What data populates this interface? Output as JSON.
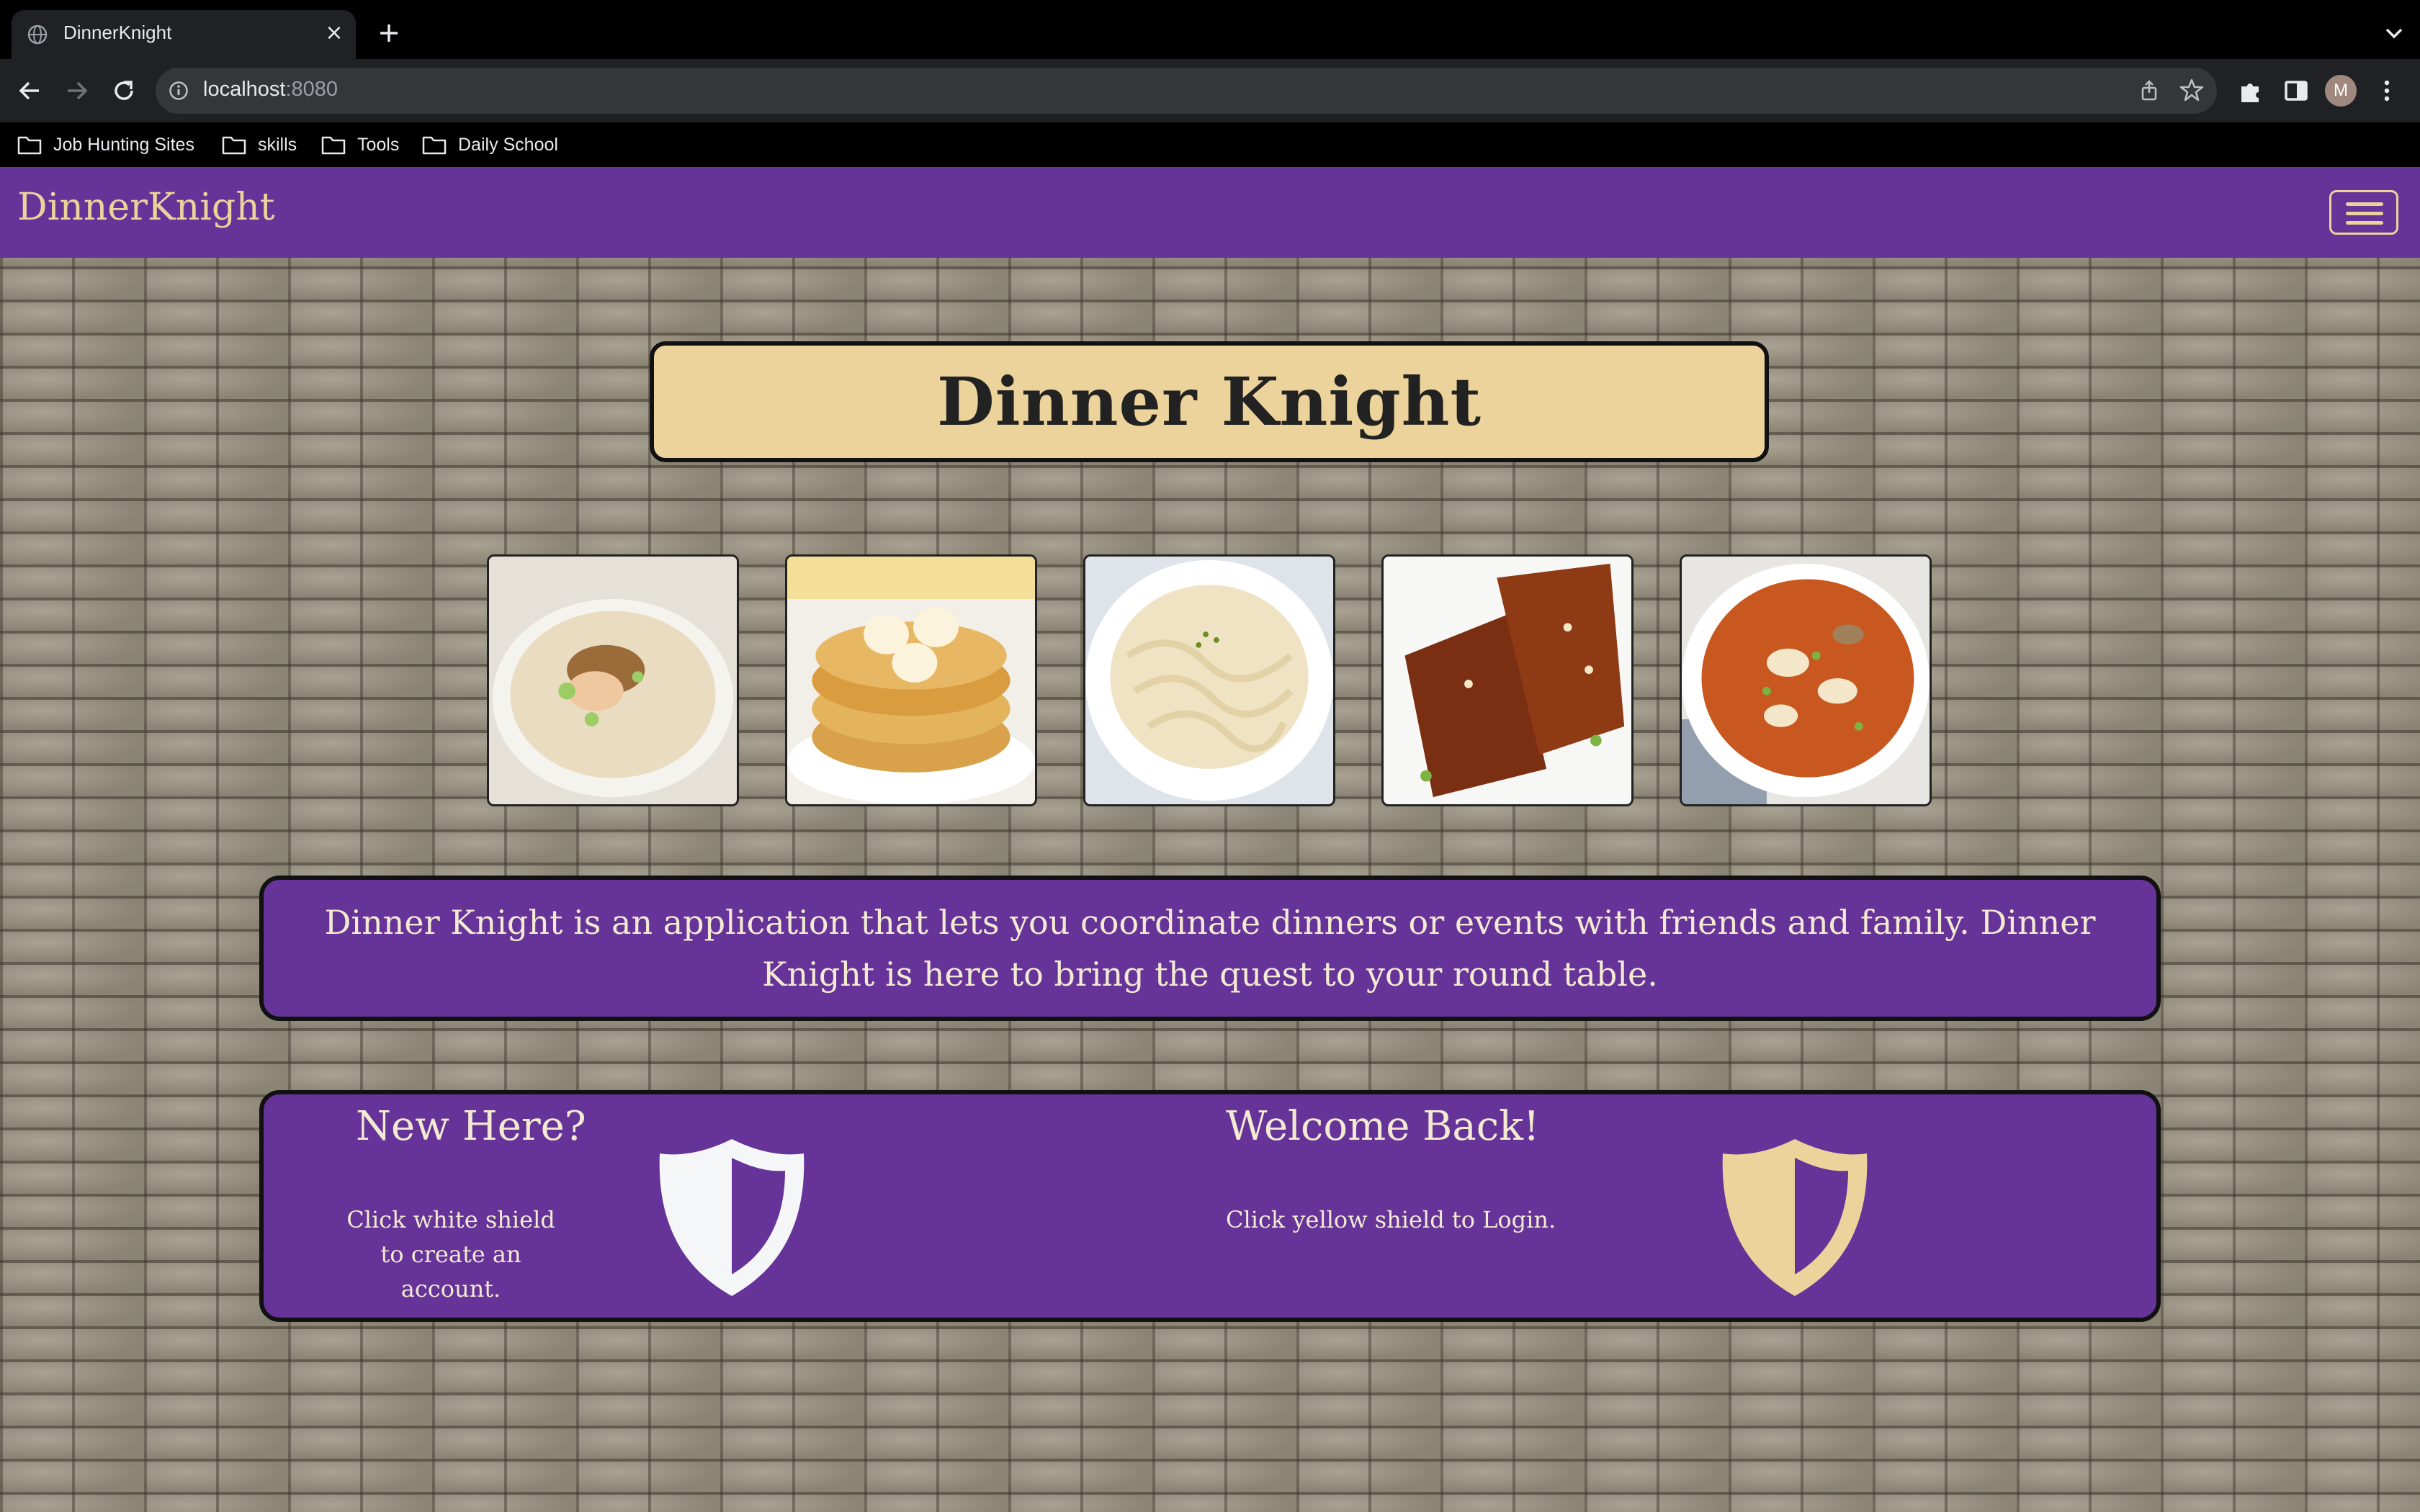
{
  "browser": {
    "tab_title": "DinnerKnight",
    "url_host": "localhost",
    "url_port": ":8080",
    "avatar_initial": "M",
    "bookmarks": [
      "Job Hunting Sites",
      "skills",
      "Tools",
      "Daily School"
    ]
  },
  "navbar": {
    "brand": "DinnerKnight"
  },
  "hero": {
    "title": "Dinner Knight"
  },
  "gallery": {
    "images": [
      "congee-image",
      "banana-pancakes-image",
      "fettuccine-alfredo-image",
      "glazed-salmon-image",
      "hot-and-sour-soup-image"
    ]
  },
  "about": {
    "text": "Dinner Knight is an application that lets you coordinate dinners or events with friends and family. Dinner Knight is here to bring the quest to your round table."
  },
  "signup": {
    "heading": "New Here?",
    "text": "Click white shield to create an account.",
    "shield_color": "#f4f6f8"
  },
  "login": {
    "heading": "Welcome Back!",
    "text": "Click yellow shield to Login.",
    "shield_color": "#ebd39b"
  },
  "colors": {
    "purple": "#663399",
    "gold": "#ebd39b"
  }
}
